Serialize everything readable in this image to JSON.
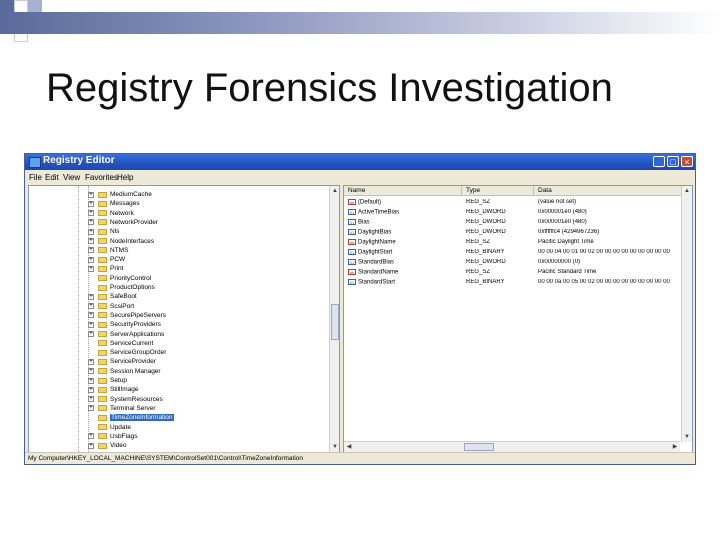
{
  "slide": {
    "title": "Registry Forensics Investigation",
    "accent_color": "#5a6a9a"
  },
  "window": {
    "title": "Registry Editor",
    "buttons": {
      "minimize": "_",
      "maximize": "□",
      "close": "×"
    },
    "menu": [
      "File",
      "Edit",
      "View",
      "Favorites",
      "Help"
    ]
  },
  "tree": {
    "items": [
      {
        "label": "MediumCache",
        "exp": "+"
      },
      {
        "label": "Messages",
        "exp": "+"
      },
      {
        "label": "Network",
        "exp": "+"
      },
      {
        "label": "NetworkProvider",
        "exp": "+"
      },
      {
        "label": "Nls",
        "exp": "+"
      },
      {
        "label": "NodeInterfaces",
        "exp": "+"
      },
      {
        "label": "NTMS",
        "exp": "+"
      },
      {
        "label": "PCW",
        "exp": "+"
      },
      {
        "label": "Print",
        "exp": "+"
      },
      {
        "label": "PriorityControl",
        "exp": ""
      },
      {
        "label": "ProductOptions",
        "exp": ""
      },
      {
        "label": "SafeBoot",
        "exp": "+"
      },
      {
        "label": "ScsiPort",
        "exp": "+"
      },
      {
        "label": "SecurePipeServers",
        "exp": "+"
      },
      {
        "label": "SecurityProviders",
        "exp": "+"
      },
      {
        "label": "ServerApplications",
        "exp": "+"
      },
      {
        "label": "ServiceCurrent",
        "exp": ""
      },
      {
        "label": "ServiceGroupOrder",
        "exp": ""
      },
      {
        "label": "ServiceProvider",
        "exp": "+"
      },
      {
        "label": "Session Manager",
        "exp": "+"
      },
      {
        "label": "Setup",
        "exp": "+"
      },
      {
        "label": "StillImage",
        "exp": "+"
      },
      {
        "label": "SystemResources",
        "exp": "+"
      },
      {
        "label": "Terminal Server",
        "exp": "+"
      },
      {
        "label": "TimeZoneInformation",
        "exp": "",
        "selected": true
      },
      {
        "label": "Update",
        "exp": ""
      },
      {
        "label": "UsbFlags",
        "exp": "+"
      },
      {
        "label": "Video",
        "exp": "+"
      }
    ]
  },
  "list": {
    "headers": {
      "name": "Name",
      "type": "Type",
      "data": "Data"
    },
    "rows": [
      {
        "icon": "ab",
        "name": "(Default)",
        "type": "REG_SZ",
        "data": "(value not set)"
      },
      {
        "icon": "bin",
        "name": "ActiveTimeBias",
        "type": "REG_DWORD",
        "data": "0x000001e0 (480)"
      },
      {
        "icon": "bin",
        "name": "Bias",
        "type": "REG_DWORD",
        "data": "0x000001e0 (480)"
      },
      {
        "icon": "bin",
        "name": "DaylightBias",
        "type": "REG_DWORD",
        "data": "0xffffffc4 (4294967236)"
      },
      {
        "icon": "ab",
        "name": "DaylightName",
        "type": "REG_SZ",
        "data": "Pacific Daylight Time"
      },
      {
        "icon": "bin",
        "name": "DaylightStart",
        "type": "REG_BINARY",
        "data": "00 00 04 00 01 00 02 00 00 00 00 00 00 00 00 00"
      },
      {
        "icon": "bin",
        "name": "StandardBias",
        "type": "REG_DWORD",
        "data": "0x00000000 (0)"
      },
      {
        "icon": "ab",
        "name": "StandardName",
        "type": "REG_SZ",
        "data": "Pacific Standard Time"
      },
      {
        "icon": "bin",
        "name": "StandardStart",
        "type": "REG_BINARY",
        "data": "00 00 0a 00 05 00 02 00 00 00 00 00 00 00 00 00"
      }
    ]
  },
  "statusbar": {
    "path": "My Computer\\HKEY_LOCAL_MACHINE\\SYSTEM\\ControlSet001\\Control\\TimeZoneInformation"
  }
}
